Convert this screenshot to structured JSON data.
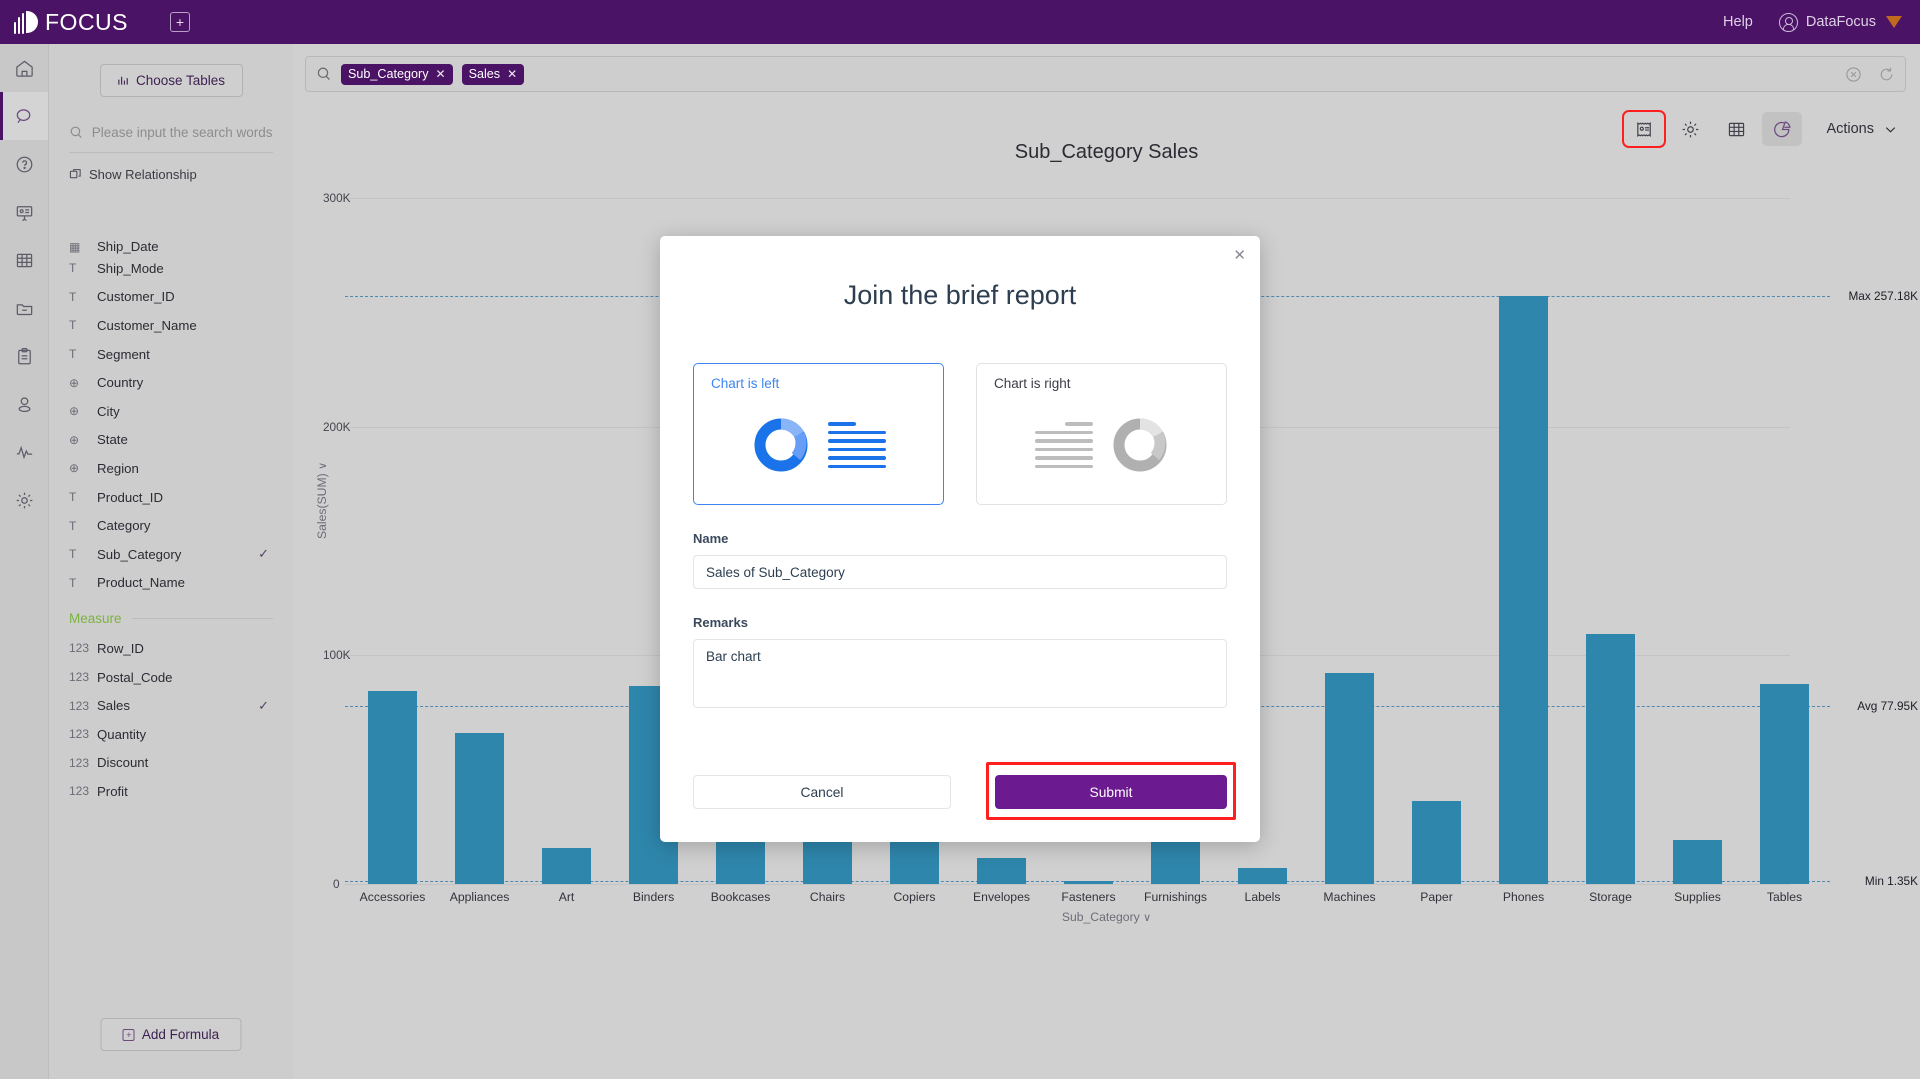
{
  "topbar": {
    "brand": "FOCUS",
    "add_tab_icon": "plus-square-icon",
    "help_label": "Help",
    "user_label": "DataFocus"
  },
  "rail": {
    "items": [
      {
        "name": "home-icon",
        "label": "Home"
      },
      {
        "name": "search-icon",
        "label": "Search",
        "active": true
      },
      {
        "name": "help-circle-icon",
        "label": "Help"
      },
      {
        "name": "presentation-icon",
        "label": "Presentation"
      },
      {
        "name": "table-icon",
        "label": "Tables"
      },
      {
        "name": "folder-minus-icon",
        "label": "Folder"
      },
      {
        "name": "clipboard-icon",
        "label": "Clipboard"
      },
      {
        "name": "user-icon",
        "label": "User"
      },
      {
        "name": "activity-icon",
        "label": "Activity"
      },
      {
        "name": "gear-icon",
        "label": "Settings"
      }
    ]
  },
  "fieldpanel": {
    "choose_tables_label": "Choose Tables",
    "search_placeholder": "Please input the search words",
    "show_relationship_label": "Show Relationship",
    "measure_label": "Measure",
    "add_formula_label": "Add Formula",
    "attributes": [
      {
        "type": "date",
        "type_glyph": "▦",
        "name": "Ship_Date",
        "checked": false,
        "clipped": true
      },
      {
        "type": "text",
        "type_glyph": "T",
        "name": "Ship_Mode",
        "checked": false
      },
      {
        "type": "text",
        "type_glyph": "T",
        "name": "Customer_ID",
        "checked": false
      },
      {
        "type": "text",
        "type_glyph": "T",
        "name": "Customer_Name",
        "checked": false
      },
      {
        "type": "text",
        "type_glyph": "T",
        "name": "Segment",
        "checked": false
      },
      {
        "type": "geo",
        "type_glyph": "⊕",
        "name": "Country",
        "checked": false
      },
      {
        "type": "geo",
        "type_glyph": "⊕",
        "name": "City",
        "checked": false
      },
      {
        "type": "geo",
        "type_glyph": "⊕",
        "name": "State",
        "checked": false
      },
      {
        "type": "geo",
        "type_glyph": "⊕",
        "name": "Region",
        "checked": false
      },
      {
        "type": "text",
        "type_glyph": "T",
        "name": "Product_ID",
        "checked": false
      },
      {
        "type": "text",
        "type_glyph": "T",
        "name": "Category",
        "checked": false
      },
      {
        "type": "text",
        "type_glyph": "T",
        "name": "Sub_Category",
        "checked": true
      },
      {
        "type": "text",
        "type_glyph": "T",
        "name": "Product_Name",
        "checked": false
      }
    ],
    "measures": [
      {
        "type": "number",
        "type_glyph": "123",
        "name": "Row_ID",
        "checked": false
      },
      {
        "type": "number",
        "type_glyph": "123",
        "name": "Postal_Code",
        "checked": false
      },
      {
        "type": "number",
        "type_glyph": "123",
        "name": "Sales",
        "checked": true
      },
      {
        "type": "number",
        "type_glyph": "123",
        "name": "Quantity",
        "checked": false
      },
      {
        "type": "number",
        "type_glyph": "123",
        "name": "Discount",
        "checked": false
      },
      {
        "type": "number",
        "type_glyph": "123",
        "name": "Profit",
        "checked": false
      }
    ]
  },
  "searchbar": {
    "tags": [
      "Sub_Category",
      "Sales"
    ],
    "tag_remove_glyph": "✕"
  },
  "charttools": {
    "items": [
      {
        "name": "brief-report-icon",
        "highlighted": true,
        "selected": false
      },
      {
        "name": "gear-icon",
        "highlighted": false,
        "selected": false
      },
      {
        "name": "table-icon",
        "highlighted": false,
        "selected": false
      },
      {
        "name": "pie-chart-icon",
        "highlighted": false,
        "selected": true
      }
    ],
    "actions_label": "Actions"
  },
  "chart_data": {
    "type": "bar",
    "title": "Sub_Category Sales",
    "xlabel": "Sub_Category",
    "ylabel": "Sales(SUM)",
    "ylim": [
      0,
      300000
    ],
    "yticks": [
      0,
      100000,
      200000,
      300000
    ],
    "ytick_labels": [
      "0",
      "100K",
      "200K",
      "300K"
    ],
    "grid": true,
    "legend": "none",
    "categories": [
      "Accessories",
      "Appliances",
      "Art",
      "Binders",
      "Bookcases",
      "Chairs",
      "Copiers",
      "Envelopes",
      "Fasteners",
      "Furnishings",
      "Labels",
      "Machines",
      "Paper",
      "Phones",
      "Storage",
      "Supplies",
      "Tables"
    ],
    "values": [
      84590,
      66110,
      15780,
      86750,
      61300,
      87790,
      86770,
      11450,
      1350,
      84220,
      7110,
      92250,
      36310,
      257180,
      109440,
      19280,
      87570
    ],
    "annotations": [
      {
        "label": "Max 257.18K",
        "value": 257180
      },
      {
        "label": "Avg 77.95K",
        "value": 77950
      },
      {
        "label": "Min 1.35K",
        "value": 1350
      }
    ]
  },
  "modal": {
    "title": "Join the brief report",
    "close_glyph": "✕",
    "layout_options": [
      {
        "label": "Chart is left",
        "selected": true
      },
      {
        "label": "Chart is right",
        "selected": false
      }
    ],
    "name_label": "Name",
    "name_value": "Sales of Sub_Category",
    "remarks_label": "Remarks",
    "remarks_value": "Bar chart",
    "cancel_label": "Cancel",
    "submit_label": "Submit"
  },
  "colors": {
    "brand_purple": "#4b1365",
    "bar_blue": "#2e86ac",
    "accent_blue": "#3d85f0",
    "submit_purple": "#6b1a8f",
    "highlight_red": "#ff1f1f",
    "measure_green": "#7cb342"
  }
}
